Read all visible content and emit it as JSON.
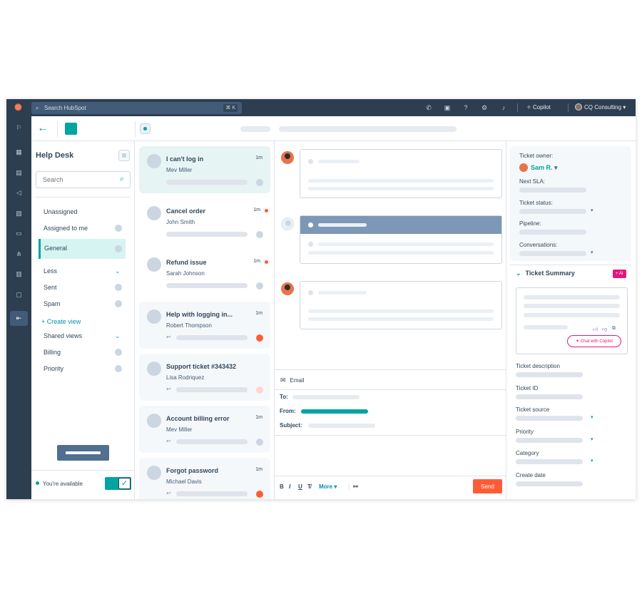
{
  "topbar": {
    "search_placeholder": "Search HubSpot",
    "search_shortcut": "⌘ K",
    "copilot_label": "Copilot",
    "account_label": "CQ Consulting"
  },
  "left": {
    "title": "Help Desk",
    "search_placeholder": "Search",
    "items": {
      "unassigned": "Unassigned",
      "assigned": "Assigned to me",
      "general": "General",
      "less": "Less",
      "sent": "Sent",
      "spam": "Spam",
      "create_view": "Create view",
      "shared_views": "Shared views",
      "billing": "Billing",
      "priority": "Priority"
    },
    "availability": "You're available"
  },
  "tickets": [
    {
      "title": "I can't log in",
      "name": "Mev Miller",
      "time": "1m"
    },
    {
      "title": "Cancel order",
      "name": "John Smith",
      "time": "1m"
    },
    {
      "title": "Refund issue",
      "name": "Sarah Johnson",
      "time": "1m"
    },
    {
      "title": "Help with logging in...",
      "name": "Robert Thompson",
      "time": "1m"
    },
    {
      "title": "Support ticket #343432",
      "name": "Lisa Rodriquez",
      "time": "1m"
    },
    {
      "title": "Account billing error",
      "name": "Mev Miller",
      "time": "1m"
    },
    {
      "title": "Forgot password",
      "name": "Michael Davis",
      "time": "1m"
    }
  ],
  "composer": {
    "channel": "Email",
    "to_label": "To:",
    "from_label": "From:",
    "subject_label": "Subject:",
    "more_label": "More",
    "send_label": "Send"
  },
  "right": {
    "owner_label": "Ticket owner:",
    "owner_name": "Sam R.",
    "next_sla_label": "Next SLA:",
    "status_label": "Ticket status:",
    "pipeline_label": "Pipeline:",
    "conversations_label": "Conversations:",
    "summary_title": "Ticket Summary",
    "ai_badge": "+ AI",
    "chat_copilot": "Chat with Copilot",
    "description_label": "Ticket description",
    "id_label": "Ticket ID",
    "source_label": "Ticket source",
    "priority_label": "Priority",
    "category_label": "Category",
    "create_date_label": "Create date"
  },
  "colors": {
    "nav": "#2d3e50",
    "accent_teal": "#00a4a0",
    "send_orange": "#ff5c35",
    "ai_pink": "#e5177e"
  }
}
